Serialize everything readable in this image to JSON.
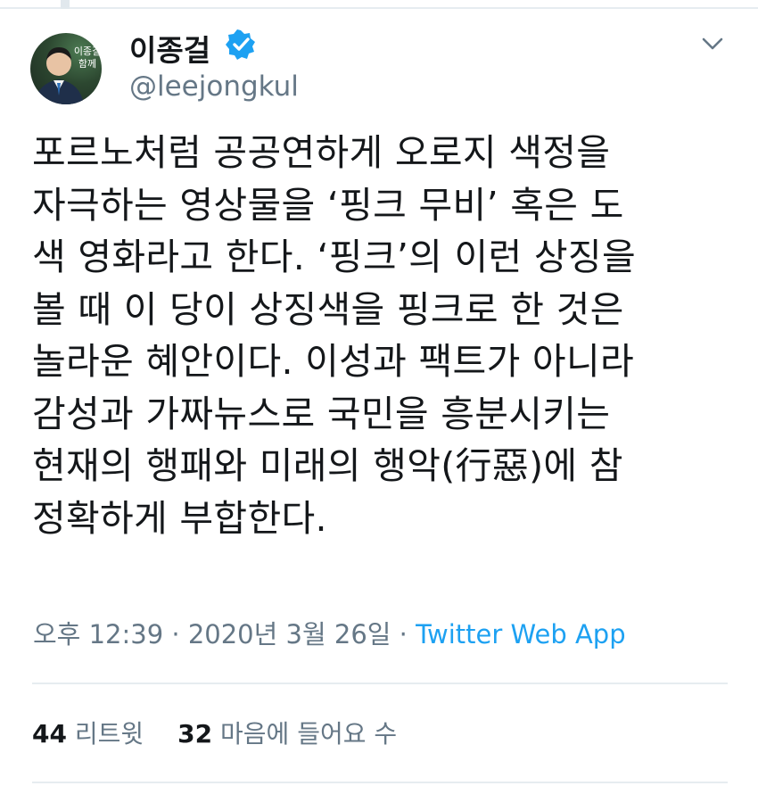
{
  "author": {
    "name": "이종걸",
    "handle": "@leejongkul",
    "verified": true,
    "avatar_overlay_text": "이종걸 함께"
  },
  "tweet": {
    "lines": [
      "포르노처럼 공공연하게 오로지 색정을",
      "자극하는 영상물을 ‘핑크 무비’ 혹은 도",
      "색 영화라고 한다. ‘핑크’의 이런 상징을",
      "볼 때 이 당이 상징색을 핑크로 한 것은",
      "놀라운 혜안이다. 이성과 팩트가 아니라",
      "감성과 가짜뉴스로 국민을 흥분시키는",
      "현재의 행패와 미래의 행악(行惡)에 참",
      "정확하게 부합한다."
    ]
  },
  "meta": {
    "time": "오후 12:39",
    "separator": " · ",
    "date": "2020년 3월 26일",
    "source": "Twitter Web App"
  },
  "stats": {
    "retweets_count": "44",
    "retweets_label": "리트윗",
    "likes_count": "32",
    "likes_label": "마음에 들어요 수"
  },
  "colors": {
    "text": "#14171a",
    "secondary": "#657786",
    "link": "#1da1f2",
    "divider": "#e6ecf0"
  }
}
